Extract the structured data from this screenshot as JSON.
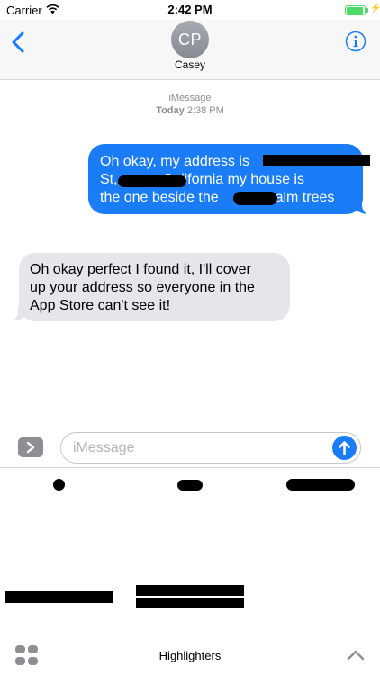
{
  "status_bar": {
    "carrier": "Carrier",
    "time": "2:42 PM",
    "battery_level": 0.95,
    "battery_color": "#4cd964"
  },
  "header": {
    "avatar_initials": "CP",
    "contact_name": "Casey",
    "back_icon": "chevron-left-icon",
    "info_icon": "info-icon",
    "accent_color": "#1a7cf7"
  },
  "thread": {
    "service": "iMessage",
    "day": "Today",
    "time": "2:38 PM"
  },
  "messages": [
    {
      "direction": "outgoing",
      "lines": [
        "Oh okay, my address is",
        "St,",
        "California my house is",
        "the one beside the",
        "palm trees"
      ],
      "redactions": 3
    },
    {
      "direction": "incoming",
      "lines": [
        "Oh okay perfect I found it, I'll cover",
        "up your address so everyone in the",
        "App Store can't see it!"
      ]
    }
  ],
  "input": {
    "placeholder": "iMessage",
    "value": ""
  },
  "drawer": {
    "title": "Highlighters",
    "stroke_color": "#000000"
  }
}
